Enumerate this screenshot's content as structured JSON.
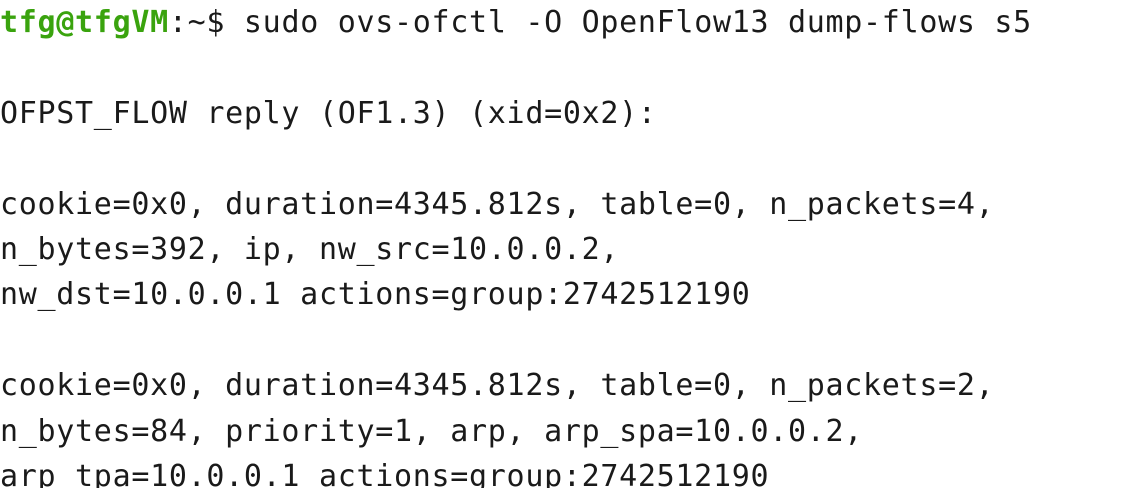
{
  "terminal": {
    "prompt": {
      "user_host": "tfg@tfgVM",
      "separator": ":",
      "cwd": "~",
      "symbol": "$",
      "command": " sudo ovs-ofctl -O OpenFlow13 dump-flows s5"
    },
    "reply_header": "OFPST_FLOW reply (OF1.3) (xid=0x2):",
    "flows": [
      {
        "lines": [
          "cookie=0x0, duration=4345.812s, table=0, n_packets=4,",
          "n_bytes=392, ip, nw_src=10.0.0.2,",
          "nw_dst=10.0.0.1 actions=group:2742512190"
        ]
      },
      {
        "lines": [
          "cookie=0x0, duration=4345.812s, table=0, n_packets=2,",
          "n_bytes=84, priority=1, arp, arp_spa=10.0.0.2,",
          "arp_tpa=10.0.0.1 actions=group:2742512190"
        ]
      }
    ],
    "colors": {
      "background": "#ffffff",
      "text": "#1a1a1a",
      "prompt_user": "#3aa30e"
    }
  }
}
